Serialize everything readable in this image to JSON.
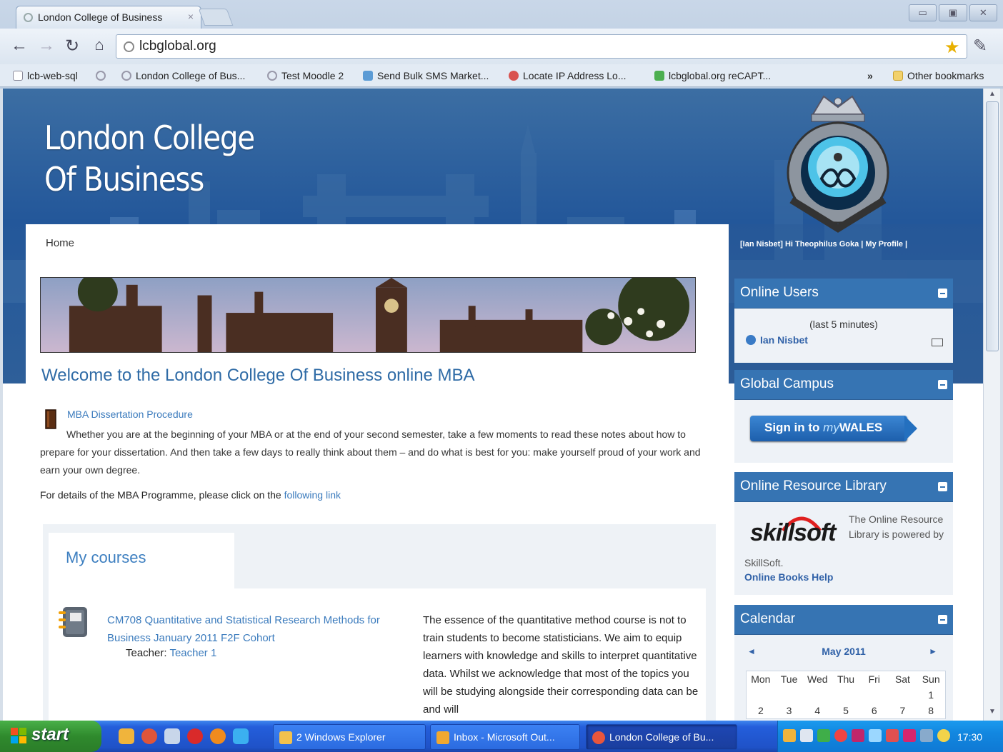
{
  "browser": {
    "tab_title": "London College of Business",
    "url": "lcbglobal.org",
    "window_buttons": [
      "▭",
      "▣",
      "✕"
    ],
    "bookmarks": [
      {
        "label": "lcb-web-sql",
        "color": "#e9eef4"
      },
      {
        "label": "",
        "color": "#e9eef4"
      },
      {
        "label": "London College of Bus...",
        "color": "#e9eef4"
      },
      {
        "label": "Test Moodle 2",
        "color": "#e9eef4"
      },
      {
        "label": "Send Bulk SMS Market...",
        "color": "#5b9bd5"
      },
      {
        "label": "Locate IP Address Lo...",
        "color": "#d9534f"
      },
      {
        "label": "lcbglobal.org reCAPT...",
        "color": "#4caf50"
      }
    ],
    "more_bookmarks": "»",
    "other_bookmarks": "Other bookmarks"
  },
  "site": {
    "title_line1": "London College",
    "title_line2": "Of Business",
    "user_nav": "[Ian Nisbet] Hi Theophilus Goka | My Profile |",
    "breadcrumb": "Home"
  },
  "main": {
    "welcome": "Welcome to the London College Of Business online MBA",
    "dissertation_link": "MBA Dissertation Procedure",
    "dissertation_text": "Whether you are at the beginning of your MBA or at the end of your second semester, take a few moments to read these notes about how to prepare for your dissertation. And then take a few days to really think about them – and do what is best for you: make yourself proud of your work and earn your own degree.",
    "mba_text": "For details of the MBA Programme, please click on the ",
    "mba_link": "following link",
    "courses_tab": "My courses",
    "course": {
      "title": "CM708 Quantitative and Statistical Research Methods for Business January 2011 F2F Cohort",
      "teacher_label": "Teacher: ",
      "teacher_name": "Teacher 1",
      "description": "The essence of the quantitative method course is not to train students to become statisticians. We aim to equip learners with knowledge and skills to interpret quantitative data. Whilst we acknowledge that most of the topics you will be studying alongside their corresponding data can be and will"
    }
  },
  "sidebar": {
    "online_users": {
      "title": "Online Users",
      "subtitle": "(last 5 minutes)",
      "user": "Ian Nisbet"
    },
    "global_campus": {
      "title": "Global Campus",
      "signin_prefix": "Sign in to ",
      "signin_my": "my",
      "signin_wales": "WALES"
    },
    "library": {
      "title": "Online Resource Library",
      "brand": "skillsoft",
      "text": "The Online Resource Library is powered by",
      "text2": "SkillSoft.",
      "help_link": "Online Books Help"
    },
    "calendar": {
      "title": "Calendar",
      "prev": "◄",
      "next": "►",
      "month": "May 2011",
      "weekdays": [
        "Mon",
        "Tue",
        "Wed",
        "Thu",
        "Fri",
        "Sat",
        "Sun"
      ],
      "week1": [
        "",
        "",
        "",
        "",
        "",
        "",
        "1"
      ],
      "week2": [
        "2",
        "3",
        "4",
        "5",
        "6",
        "7",
        "8"
      ]
    }
  },
  "taskbar": {
    "start": "start",
    "tasks": [
      {
        "label": "2 Windows Explorer",
        "color": "#f2c14e",
        "active": false
      },
      {
        "label": "Inbox - Microsoft Out...",
        "color": "#f0a830",
        "active": false
      },
      {
        "label": "London College of Bu...",
        "color": "#e9563c",
        "active": true
      }
    ],
    "clock": "17:30"
  },
  "colors": {
    "banner": "#23579a",
    "block_header": "#3674b3",
    "link": "#3b7bbd"
  }
}
